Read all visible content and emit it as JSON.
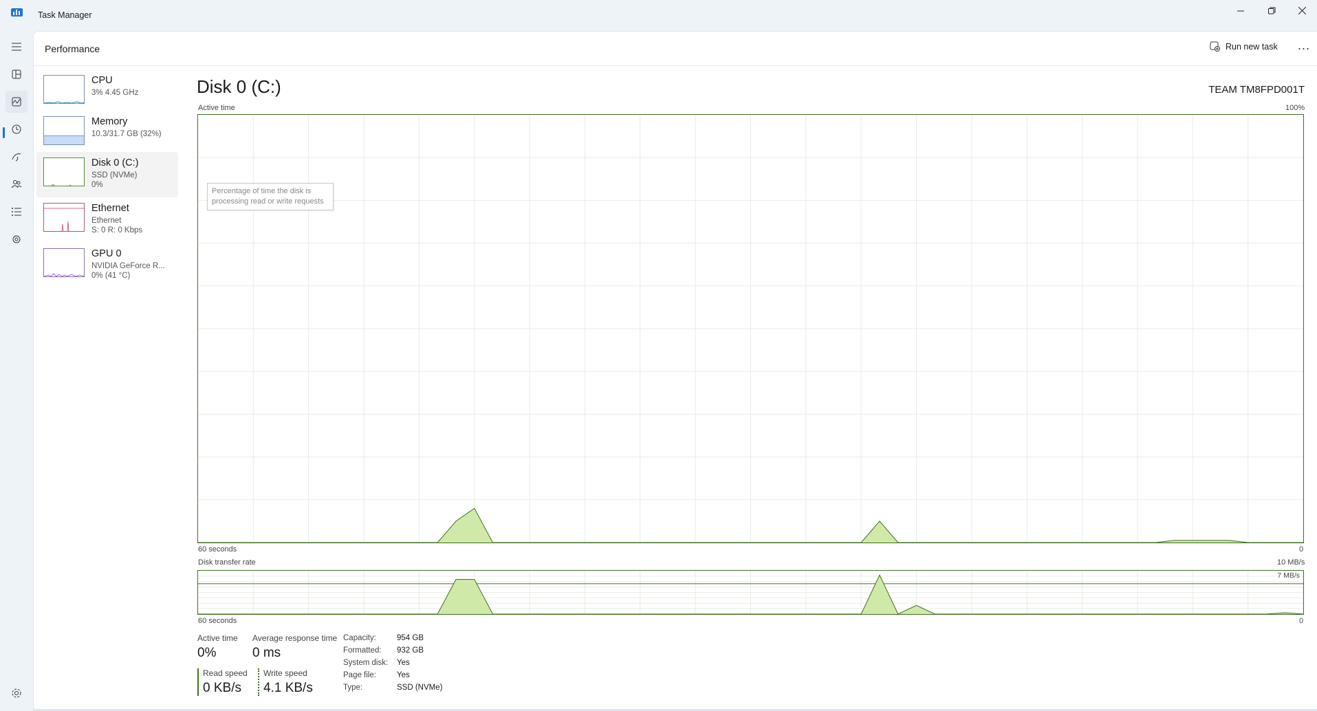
{
  "window": {
    "title": "Task Manager"
  },
  "header": {
    "page_title": "Performance",
    "run_new_task": "Run new task",
    "more": "..."
  },
  "devices": [
    {
      "name": "CPU",
      "line2": "3% 4.45 GHz",
      "line3": ""
    },
    {
      "name": "Memory",
      "line2": "10.3/31.7 GB (32%)",
      "line3": ""
    },
    {
      "name": "Disk 0 (C:)",
      "line2": "SSD (NVMe)",
      "line3": "0%"
    },
    {
      "name": "Ethernet",
      "line2": "Ethernet",
      "line3": "S: 0 R: 0 Kbps"
    },
    {
      "name": "GPU 0",
      "line2": "NVIDIA GeForce R...",
      "line3": "0% (41 °C)"
    }
  ],
  "detail": {
    "title": "Disk 0 (C:)",
    "model": "TEAM TM8FPD001T",
    "active_time_label": "Active time",
    "active_time_max": "100%",
    "time_span": "60 seconds",
    "zero": "0",
    "tooltip": "Percentage of time the disk is processing read or write requests",
    "transfer_label": "Disk transfer rate",
    "transfer_max": "10 MB/s",
    "transfer_marker": "7 MB/s"
  },
  "stats": {
    "active_time_label": "Active time",
    "active_time_value": "0%",
    "avg_response_label": "Average response time",
    "avg_response_value": "0 ms",
    "read_label": "Read speed",
    "read_value": "0 KB/s",
    "write_label": "Write speed",
    "write_value": "4.1 KB/s"
  },
  "properties": [
    {
      "key": "Capacity:",
      "value": "954 GB"
    },
    {
      "key": "Formatted:",
      "value": "932 GB"
    },
    {
      "key": "System disk:",
      "value": "Yes"
    },
    {
      "key": "Page file:",
      "value": "Yes"
    },
    {
      "key": "Type:",
      "value": "SSD (NVMe)"
    }
  ],
  "colors": {
    "accent": "#1f6fd1",
    "disk_line": "#3f6e1f",
    "disk_fill": "#cfeaa8",
    "memory": "#8fb7e6",
    "ethernet": "#c93c76",
    "gpu": "#8a3fc9",
    "cpu": "#2a7fb3"
  },
  "chart_data": [
    {
      "type": "area",
      "x_label": "60 seconds",
      "ylim": [
        0,
        100
      ],
      "x": [
        0,
        1,
        2,
        3,
        4,
        5,
        6,
        7,
        8,
        9,
        10,
        11,
        12,
        13,
        14,
        15,
        16,
        17,
        18,
        19,
        20,
        21,
        22,
        23,
        24,
        25,
        26,
        27,
        28,
        29,
        30,
        31,
        32,
        33,
        34,
        35,
        36,
        37,
        38,
        39,
        40,
        41,
        42,
        43,
        44,
        45,
        46,
        47,
        48,
        49,
        50,
        51,
        52,
        53,
        54,
        55,
        56,
        57,
        58,
        59,
        60
      ],
      "values": [
        0,
        0,
        0,
        0,
        0,
        0,
        0,
        0,
        0,
        0,
        0,
        0,
        0,
        0,
        5,
        8,
        0,
        0,
        0,
        0,
        0,
        0,
        0,
        0,
        0,
        0,
        0,
        0,
        0,
        0,
        0,
        0,
        0,
        0,
        0,
        0,
        0,
        5,
        0,
        0,
        0,
        0,
        0,
        0,
        0,
        0,
        0,
        0,
        0,
        0,
        0,
        0,
        0,
        0.5,
        0.5,
        0.5,
        0.5,
        0,
        0,
        0,
        0
      ]
    },
    {
      "type": "area",
      "x_label": "60 seconds",
      "ylim": [
        0,
        10
      ],
      "x": [
        0,
        1,
        2,
        3,
        4,
        5,
        6,
        7,
        8,
        9,
        10,
        11,
        12,
        13,
        14,
        15,
        16,
        17,
        18,
        19,
        20,
        21,
        22,
        23,
        24,
        25,
        26,
        27,
        28,
        29,
        30,
        31,
        32,
        33,
        34,
        35,
        36,
        37,
        38,
        39,
        40,
        41,
        42,
        43,
        44,
        45,
        46,
        47,
        48,
        49,
        50,
        51,
        52,
        53,
        54,
        55,
        56,
        57,
        58,
        59,
        60
      ],
      "values": [
        0,
        0,
        0,
        0,
        0,
        0,
        0,
        0,
        0,
        0,
        0,
        0,
        0,
        0,
        8,
        8,
        0,
        0,
        0,
        0,
        0,
        0,
        0,
        0,
        0,
        0,
        0,
        0,
        0,
        0,
        0,
        0,
        0,
        0,
        0,
        0,
        0,
        9,
        0,
        2,
        0,
        0,
        0,
        0,
        0,
        0,
        0,
        0,
        0,
        0,
        0,
        0,
        0,
        0,
        0,
        0,
        0,
        0,
        0,
        0.3,
        0
      ]
    }
  ]
}
